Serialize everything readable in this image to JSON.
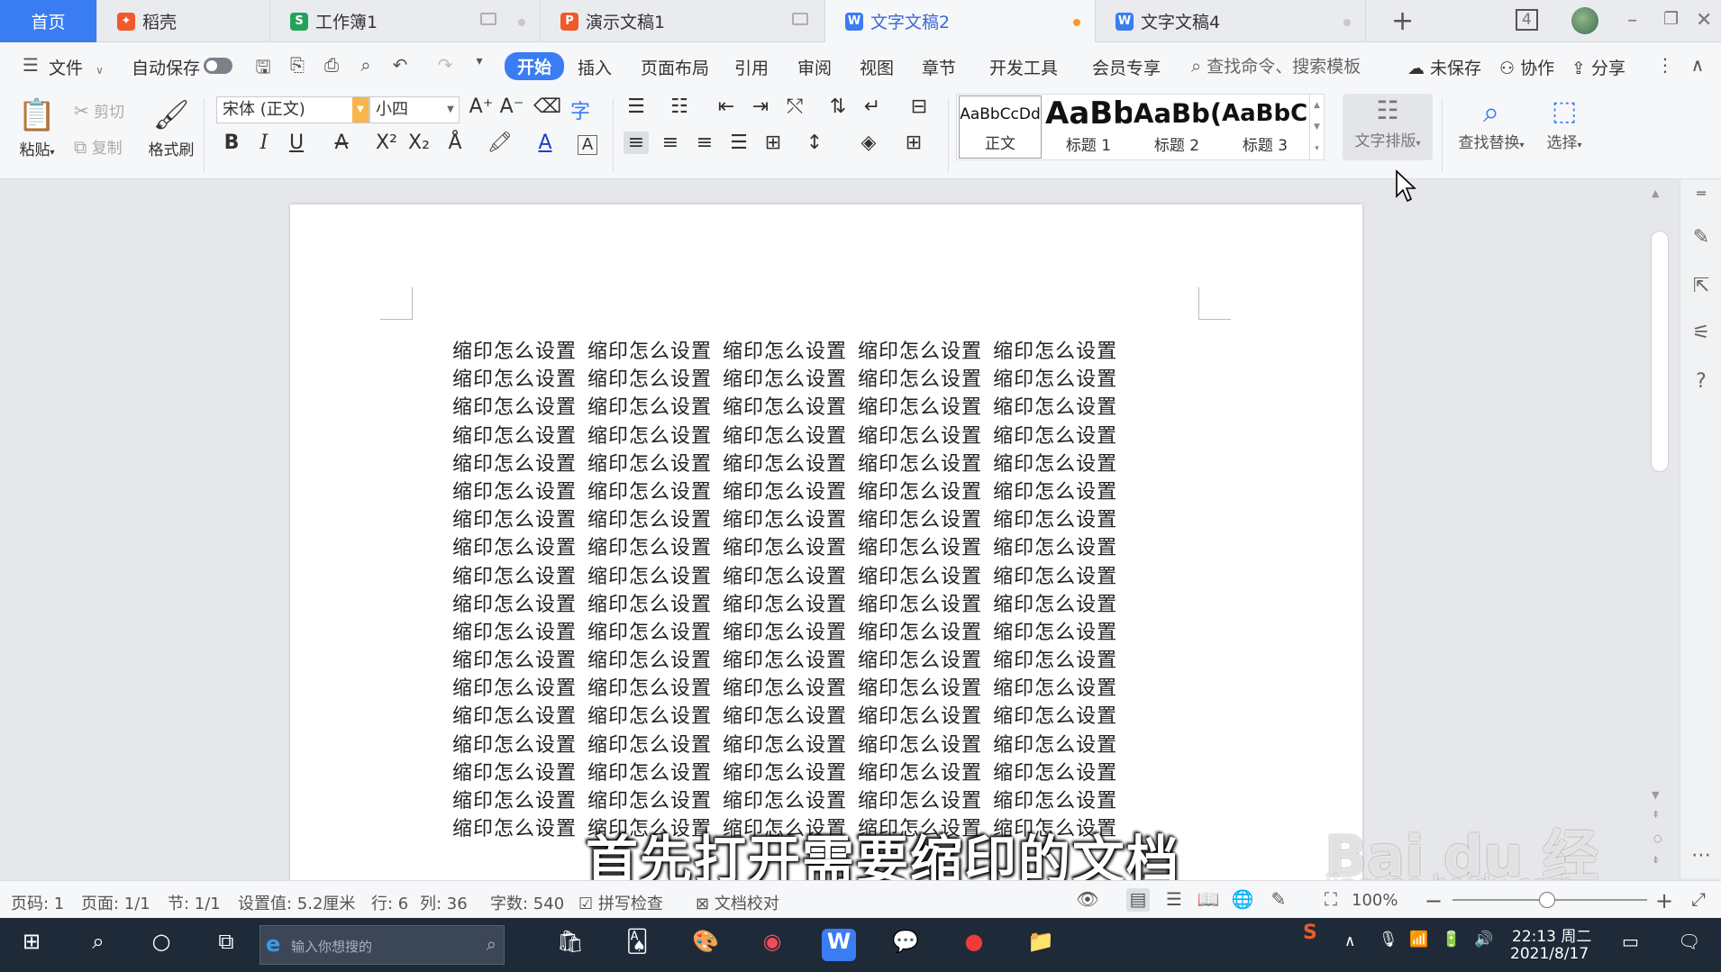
{
  "tabs": [
    {
      "label": "首页",
      "kind": "home"
    },
    {
      "label": "稻壳",
      "kind": "docer",
      "icon_color": "#f0592a"
    },
    {
      "label": "工作簿1",
      "kind": "sheet",
      "icon_color": "#23a35a"
    },
    {
      "label": "演示文稿1",
      "kind": "ppt",
      "icon_color": "#f0592a"
    },
    {
      "label": "文字文稿2",
      "kind": "doc",
      "icon_color": "#3a7cf2",
      "active": true
    },
    {
      "label": "文字文稿4",
      "kind": "doc",
      "icon_color": "#3a7cf2"
    }
  ],
  "window": {
    "tab_count": "4"
  },
  "menubar": {
    "file_label": "文件",
    "autosave_label": "自动保存",
    "items": [
      "开始",
      "插入",
      "页面布局",
      "引用",
      "审阅",
      "视图",
      "章节",
      "开发工具",
      "会员专享"
    ],
    "active_item": "开始",
    "search_placeholder": "查找命令、搜索模板",
    "unsaved_label": "未保存",
    "collab_label": "协作",
    "share_label": "分享"
  },
  "ribbon": {
    "paste_label": "粘贴",
    "cut_label": "剪切",
    "copy_label": "复制",
    "format_painter_label": "格式刷",
    "font_name": "宋体 (正文)",
    "font_size": "小四",
    "styles": [
      {
        "sample": "AaBbCcDd",
        "name": "正文"
      },
      {
        "sample": "AaBb",
        "name": "标题 1"
      },
      {
        "sample": "AaBb(",
        "name": "标题 2"
      },
      {
        "sample": "AaBbC(",
        "name": "标题 3"
      }
    ],
    "text_layout_label": "文字排版",
    "find_replace_label": "查找替换",
    "select_label": "选择"
  },
  "document": {
    "phrase": "缩印怎么设置",
    "rows": 18,
    "cols": 5
  },
  "subtitle": "首先打开需要缩印的文档",
  "watermark": {
    "brand": "Bai du 经验",
    "url": "jingyan.baidu.com"
  },
  "statusbar": {
    "page_code": "页码: 1",
    "page": "页面: 1/1",
    "section": "节: 1/1",
    "setting": "设置值: 5.2厘米",
    "row": "行: 6",
    "col": "列: 36",
    "word_count": "字数: 540",
    "spell_check": "拼写检查",
    "doc_proof": "文档校对",
    "zoom": "100%"
  },
  "taskbar": {
    "search_placeholder": "输入你想搜的",
    "time": "22:13 周二",
    "date": "2021/8/17"
  }
}
